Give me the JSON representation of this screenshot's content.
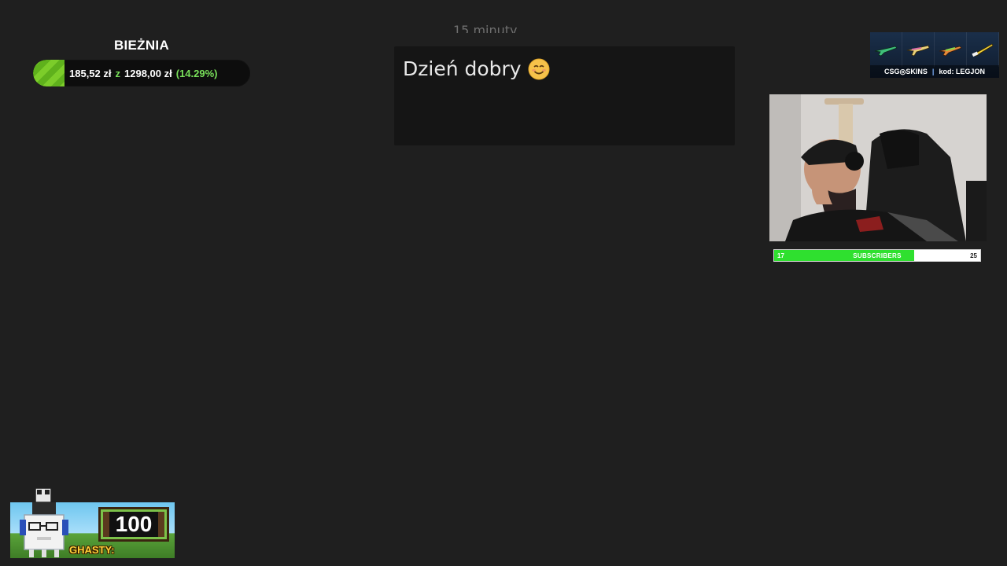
{
  "goal": {
    "title": "BIEŻNIA",
    "current": "185,52 zł",
    "of_label": "z",
    "target": "1298,00 zł",
    "percent_text": "(14.29%)",
    "progress_fraction": 0.1429
  },
  "chat": {
    "ghost_text": "15 minuty",
    "message": "Dzień dobry",
    "emoji_icon": "smiling-face-icon"
  },
  "sponsor": {
    "brand": "CSG◎SKINS",
    "code_label": "kod: LEGJON",
    "item_icons": [
      "rifle-skin-icon",
      "rifle-skin-icon",
      "rifle-skin-icon",
      "knife-skin-icon"
    ]
  },
  "webcam": {
    "icon": "webcam-feed-icon"
  },
  "subscribers": {
    "label": "SUBSCRIBERS",
    "current": "17",
    "goal": "25",
    "progress_fraction": 0.68,
    "color": "#2fe02f"
  },
  "ghasts": {
    "count": "100",
    "label": "GHASTY:"
  }
}
